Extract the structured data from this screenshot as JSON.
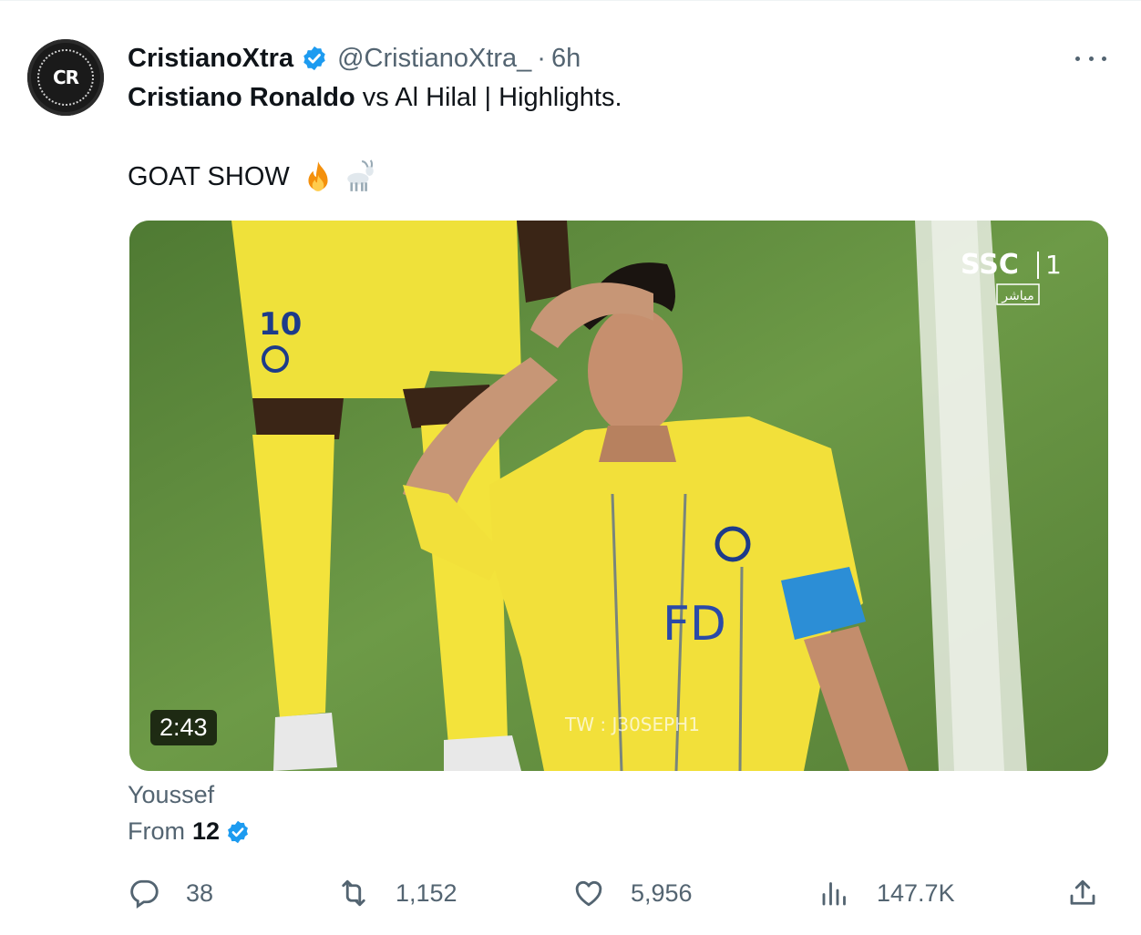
{
  "tweet": {
    "display_name": "CristianoXtra",
    "handle": "@CristianoXtra_",
    "separator": "·",
    "time": "6h",
    "avatar_text": "CR",
    "text_bold": "Cristiano Ronaldo",
    "text_rest": " vs Al Hilal | Highlights.",
    "text_line2": "GOAT SHOW",
    "emojis": [
      "fire-emoji",
      "goat-emoji"
    ]
  },
  "media": {
    "duration": "2:43",
    "broadcaster": "SSC",
    "channel": "1",
    "live_label": "مباشر",
    "jersey_number": "10",
    "watermark": "TW : J30SEPH1",
    "shirt_text": "FD"
  },
  "attribution": {
    "line1": "Youssef",
    "line2_prefix": "From",
    "line2_count": "12"
  },
  "actions": {
    "replies": "38",
    "reposts": "1,152",
    "likes": "5,956",
    "views": "147.7K"
  },
  "colors": {
    "verified": "#1d9bf0",
    "secondary_text": "#536471",
    "primary_text": "#0f1419",
    "jersey_yellow": "#f2e03a"
  }
}
